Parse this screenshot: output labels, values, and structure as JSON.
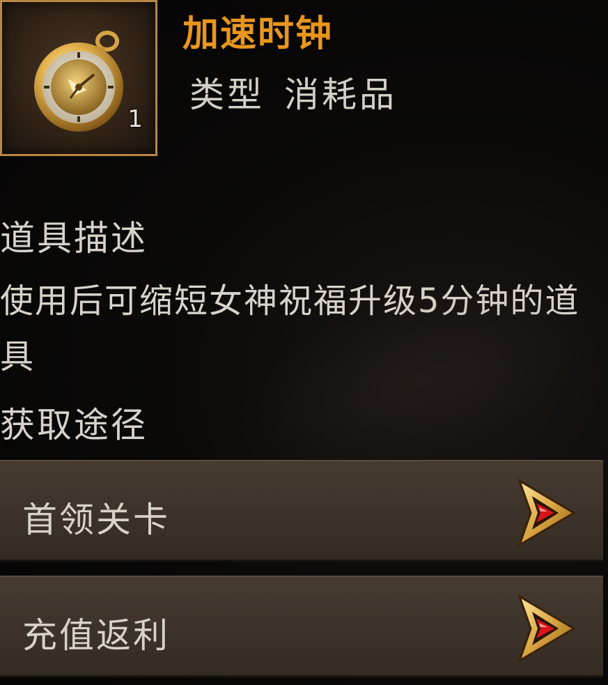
{
  "item": {
    "name": "加速时钟",
    "count": "1",
    "type_label": "类型",
    "type_value": "消耗品"
  },
  "description": {
    "title": "道具描述",
    "text": "使用后可缩短女神祝福升级5分钟的道具"
  },
  "sources": {
    "title": "获取途径",
    "items": [
      {
        "label": "首领关卡",
        "icon": "arrow-right-icon"
      },
      {
        "label": "充值返利",
        "icon": "arrow-right-icon"
      }
    ]
  },
  "colors": {
    "name": "#e8961d",
    "text": "#d8d3ca",
    "frame": "#b98646",
    "button_bg": "#3c3229",
    "arrow_gold": "#d9a441",
    "arrow_red": "#d8141a"
  }
}
